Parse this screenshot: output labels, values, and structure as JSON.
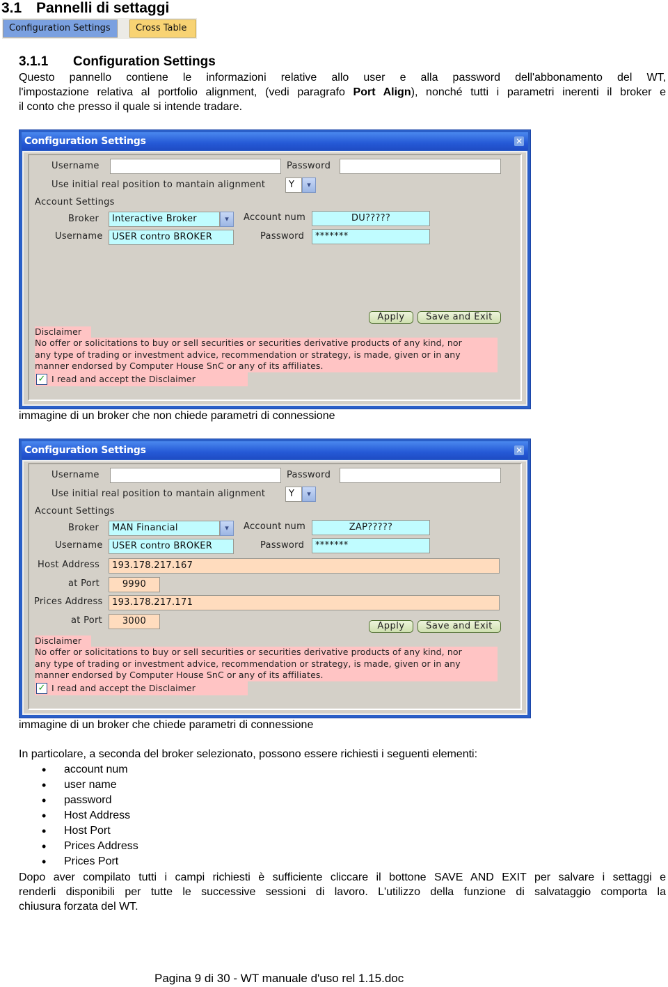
{
  "section": {
    "number": "3.1",
    "title": "Pannelli di settaggi"
  },
  "tabs": [
    {
      "label": "Configuration Settings",
      "color": "#7aa0e0"
    },
    {
      "label": "Cross Table",
      "color": "#f8d373"
    }
  ],
  "subsection": {
    "number": "3.1.1",
    "title": "Configuration Settings"
  },
  "intro": {
    "line1": "Questo pannello contiene le informazioni relative allo user e alla password dell'abbonamento del WT,",
    "line2_pre": "l'impostazione relativa al portfolio alignment, (vedi paragrafo ",
    "line2_bold": "Port Align",
    "line2_post": "), nonché tutti i parametri inerenti il broker e",
    "line3": "il conto che presso il quale  si intende tradare."
  },
  "window_common": {
    "title": "Configuration Settings",
    "close_glyph": "✕",
    "username_label": "Username",
    "password_label": "Password",
    "username_value": "",
    "password_value": "",
    "alignment_label": "Use initial real position to mantain alignment",
    "alignment_value": "Y",
    "account_settings_label": "Account Settings",
    "broker_label": "Broker",
    "account_num_label": "Account num",
    "broker_username_label": "Username",
    "broker_password_label": "Password",
    "broker_username_value": "USER contro BROKER",
    "broker_password_value": "*******",
    "apply_label": "Apply",
    "save_exit_label": "Save and Exit",
    "disclaimer_title": "Disclaimer",
    "disclaimer_lines": [
      "No offer or solicitations to buy or sell securities or securities derivative products of any kind, nor",
      "any type of trading or investment advice, recommendation or strategy, is made, given or in any",
      "manner endorsed by Computer House SnC or any of its affiliates."
    ],
    "accept_label": "I read and accept the Disclaimer",
    "accept_checked": true,
    "dropdown_glyph": "▾"
  },
  "window1": {
    "broker_value": "Interactive Broker",
    "account_num_value": "DU?????"
  },
  "caption1": "immagine di un broker che non chiede parametri di connessione",
  "window2": {
    "broker_value": "MAN Financial",
    "account_num_value": "ZAP?????",
    "host_address_label": "Host Address",
    "host_address_value": "193.178.217.167",
    "host_port_label": "at Port",
    "host_port_value": "9990",
    "prices_address_label": "Prices Address",
    "prices_address_value": "193.178.217.171",
    "prices_port_label": "at Port",
    "prices_port_value": "3000"
  },
  "caption2": "immagine di un broker che chiede parametri di connessione",
  "list_intro": "In particolare, a seconda del broker selezionato, possono essere richiesti i seguenti elementi:",
  "list_items": [
    "account num",
    "user name",
    "password",
    "Host Address",
    "Host Port",
    "Prices Address",
    "Prices Port"
  ],
  "closing": {
    "line1": "Dopo aver compilato tutti i campi richiesti è sufficiente cliccare il bottone SAVE AND EXIT per salvare i settaggi e",
    "line2": "renderli disponibili per tutte le successive sessioni di lavoro. L'utilizzo della funzione di salvataggio comporta la",
    "line3": "chiusura forzata del WT."
  },
  "footer": "Pagina 9 di 30 - WT manuale d'uso rel 1.15.doc"
}
